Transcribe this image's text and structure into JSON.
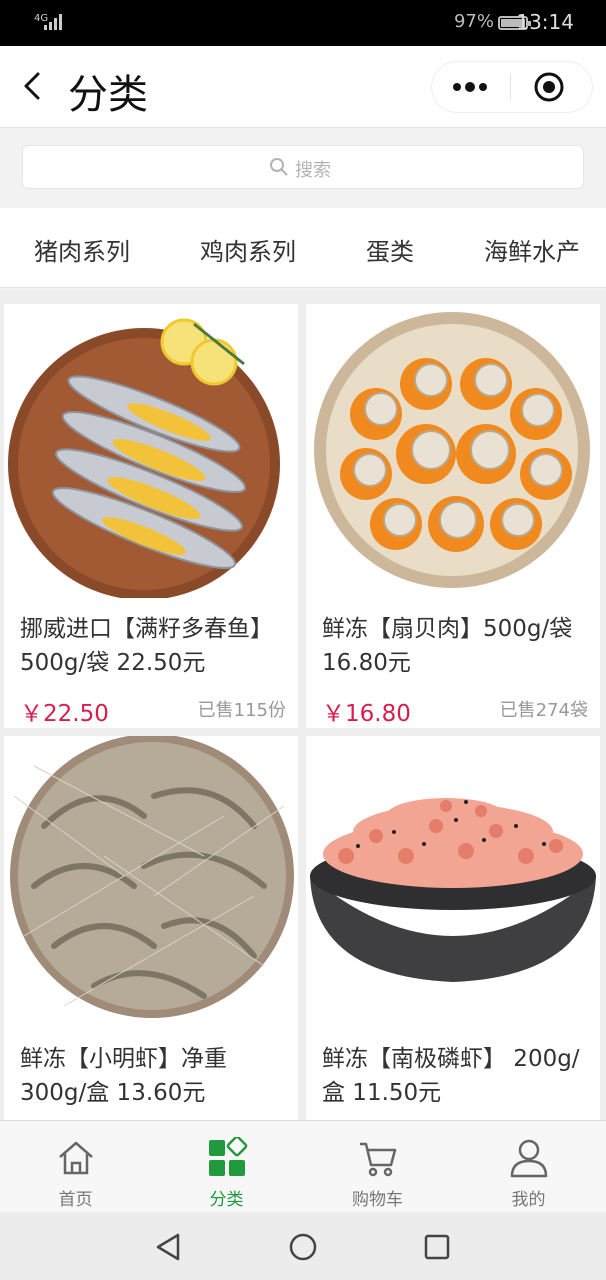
{
  "status_bar": {
    "network": "4G",
    "battery": "97%",
    "time": "13:14"
  },
  "nav": {
    "title": "分类",
    "more_icon": "more-dots-icon",
    "close_icon": "target-close-icon"
  },
  "search": {
    "placeholder": "搜索"
  },
  "categories": [
    "猪肉系列",
    "鸡肉系列",
    "蛋类",
    "海鲜水产"
  ],
  "products": [
    {
      "title": "挪威进口【满籽多春鱼】500g/袋 22.50元",
      "price": "￥22.50",
      "sold": "已售115份"
    },
    {
      "title": "鲜冻【扇贝肉】500g/袋 16.80元",
      "price": "￥16.80",
      "sold": "已售274袋"
    },
    {
      "title": "鲜冻【小明虾】净重300g/盒 13.60元",
      "price": "",
      "sold": ""
    },
    {
      "title": "鲜冻【南极磷虾】 200g/盒 11.50元",
      "price": "",
      "sold": ""
    }
  ],
  "tab_bar": [
    {
      "label": "首页",
      "icon": "home-icon"
    },
    {
      "label": "分类",
      "icon": "category-icon",
      "active": true
    },
    {
      "label": "购物车",
      "icon": "cart-icon"
    },
    {
      "label": "我的",
      "icon": "user-icon"
    }
  ],
  "colors": {
    "accent": "#1f9a3c",
    "price": "#d81e4e"
  }
}
